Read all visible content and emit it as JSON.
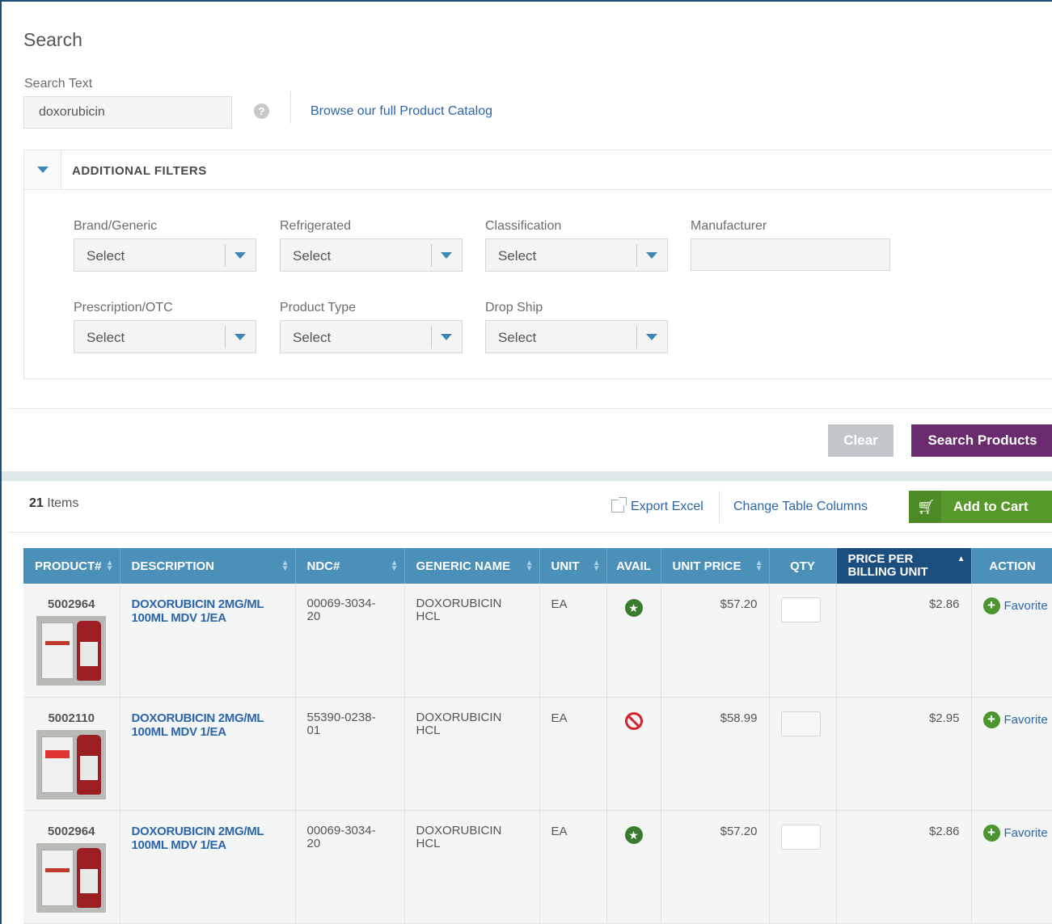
{
  "search": {
    "title": "Search",
    "label": "Search Text",
    "value": "doxorubicin",
    "help_icon": "question-icon",
    "catalog_link": "Browse our full Product Catalog"
  },
  "filters": {
    "title": "ADDITIONAL FILTERS",
    "brand_generic": {
      "label": "Brand/Generic",
      "value": "Select"
    },
    "refrigerated": {
      "label": "Refrigerated",
      "value": "Select"
    },
    "classification": {
      "label": "Classification",
      "value": "Select"
    },
    "manufacturer": {
      "label": "Manufacturer",
      "value": ""
    },
    "prescription_otc": {
      "label": "Prescription/OTC",
      "value": "Select"
    },
    "product_type": {
      "label": "Product Type",
      "value": "Select"
    },
    "drop_ship": {
      "label": "Drop Ship",
      "value": "Select"
    }
  },
  "buttons": {
    "clear": "Clear",
    "search_products": "Search Products"
  },
  "results": {
    "count": "21",
    "count_suffix": " Items",
    "export_excel": "Export Excel",
    "change_columns": "Change Table Columns",
    "add_to_cart": "Add to Cart",
    "columns": {
      "product": "PRODUCT#",
      "description": "DESCRIPTION",
      "ndc": "NDC#",
      "generic_name": "GENERIC NAME",
      "unit": "UNIT",
      "avail": "AVAIL",
      "unit_price": "UNIT PRICE",
      "qty": "QTY",
      "price_per_billing_unit_line1": "PRICE PER",
      "price_per_billing_unit_line2": "BILLING UNIT",
      "action": "ACTION"
    },
    "rows": [
      {
        "product": "5002964",
        "description_line1": "DOXORUBICIN 2MG/ML",
        "description_line2": "100ML MDV 1/EA",
        "ndc_line1": "00069-3034-",
        "ndc_line2": "20",
        "generic_line1": "DOXORUBICIN",
        "generic_line2": "HCL",
        "unit": "EA",
        "avail": "available",
        "unit_price": "$57.20",
        "qty": "",
        "price_per_billing_unit": "$2.86",
        "action": "Favorite"
      },
      {
        "product": "5002110",
        "description_line1": "DOXORUBICIN 2MG/ML",
        "description_line2": "100ML MDV 1/EA",
        "ndc_line1": "55390-0238-",
        "ndc_line2": "01",
        "generic_line1": "DOXORUBICIN",
        "generic_line2": "HCL",
        "unit": "EA",
        "avail": "unavailable",
        "unit_price": "$58.99",
        "qty": "",
        "price_per_billing_unit": "$2.95",
        "action": "Favorite"
      },
      {
        "product": "5002964",
        "description_line1": "DOXORUBICIN 2MG/ML",
        "description_line2": "100ML MDV 1/EA",
        "ndc_line1": "00069-3034-",
        "ndc_line2": "20",
        "generic_line1": "DOXORUBICIN",
        "generic_line2": "HCL",
        "unit": "EA",
        "avail": "available",
        "unit_price": "$57.20",
        "qty": "",
        "price_per_billing_unit": "$2.86",
        "action": "Favorite"
      }
    ]
  },
  "colors": {
    "header_blue": "#4a90b9",
    "header_sorted": "#1b4e7c",
    "search_button": "#6a2c6f",
    "cart_button": "#57982b",
    "link": "#2c66a8",
    "available": "#3b7b30",
    "unavailable": "#d3232d"
  }
}
